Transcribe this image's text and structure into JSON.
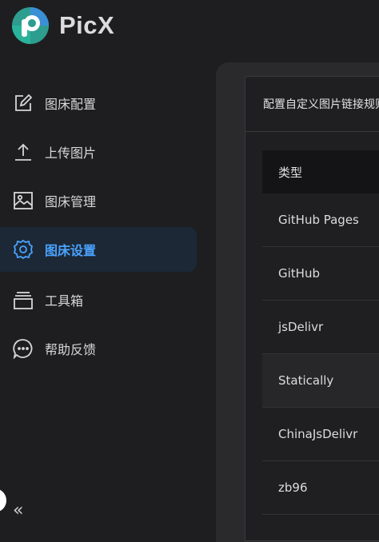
{
  "app": {
    "name": "PicX"
  },
  "sidebar": {
    "items": [
      {
        "label": "图床配置",
        "icon": "edit-icon",
        "active": false
      },
      {
        "label": "上传图片",
        "icon": "upload-icon",
        "active": false
      },
      {
        "label": "图床管理",
        "icon": "image-icon",
        "active": false
      },
      {
        "label": "图床设置",
        "icon": "gear-icon",
        "active": true
      },
      {
        "label": "工具箱",
        "icon": "toolbox-icon",
        "active": false
      },
      {
        "label": "帮助反馈",
        "icon": "chat-icon",
        "active": false
      }
    ],
    "collapse_label": "«"
  },
  "card": {
    "title": "配置自定义图片链接规则"
  },
  "table": {
    "header": "类型",
    "rows": [
      "GitHub Pages",
      "GitHub",
      "jsDelivr",
      "Statically",
      "ChinaJsDelivr",
      "zb96"
    ]
  },
  "colors": {
    "accent": "#4aa3ff",
    "background": "#1e1e21"
  }
}
